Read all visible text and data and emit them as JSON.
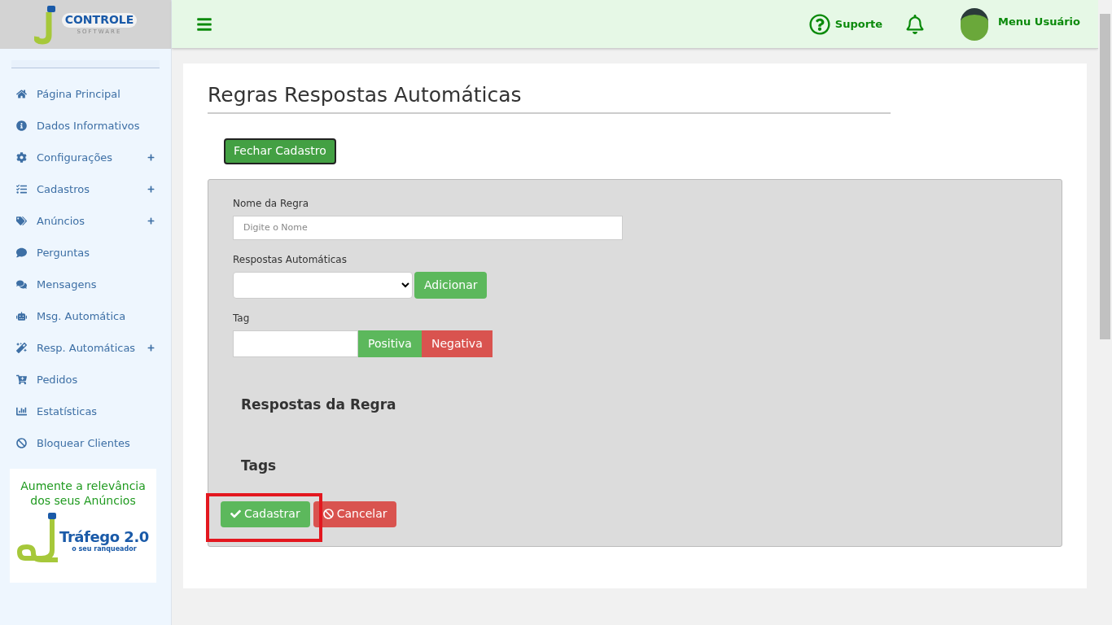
{
  "logo": {
    "name": "CONTROLE",
    "subtitle": "SOFTWARE"
  },
  "header": {
    "support": "Suporte",
    "user_menu": "Menu Usuário"
  },
  "sidebar": {
    "items": [
      {
        "label": "Página Principal",
        "expandable": false
      },
      {
        "label": "Dados Informativos",
        "expandable": false
      },
      {
        "label": "Configurações",
        "expandable": true
      },
      {
        "label": "Cadastros",
        "expandable": true
      },
      {
        "label": "Anúncios",
        "expandable": true
      },
      {
        "label": "Perguntas",
        "expandable": false
      },
      {
        "label": "Mensagens",
        "expandable": false
      },
      {
        "label": "Msg. Automática",
        "expandable": false
      },
      {
        "label": "Resp. Automáticas",
        "expandable": true
      },
      {
        "label": "Pedidos",
        "expandable": false
      },
      {
        "label": "Estatísticas",
        "expandable": false
      },
      {
        "label": "Bloquear Clientes",
        "expandable": false
      }
    ],
    "banner": {
      "headline": "Aumente a relevância dos seus Anúncios",
      "product": "Tráfego 2.0",
      "tagline": "o seu ranqueador"
    }
  },
  "page": {
    "title": "Regras Respostas Automáticas",
    "close_button": "Fechar Cadastro",
    "form": {
      "rule_name_label": "Nome da Regra",
      "rule_name_placeholder": "Digite o Nome",
      "responses_label": "Respostas Automáticas",
      "add_button": "Adicionar",
      "tag_label": "Tag",
      "positive_button": "Positiva",
      "negative_button": "Negativa",
      "rule_responses_heading": "Respostas da Regra",
      "tags_heading": "Tags",
      "submit_button": "Cadastrar",
      "cancel_button": "Cancelar"
    }
  }
}
